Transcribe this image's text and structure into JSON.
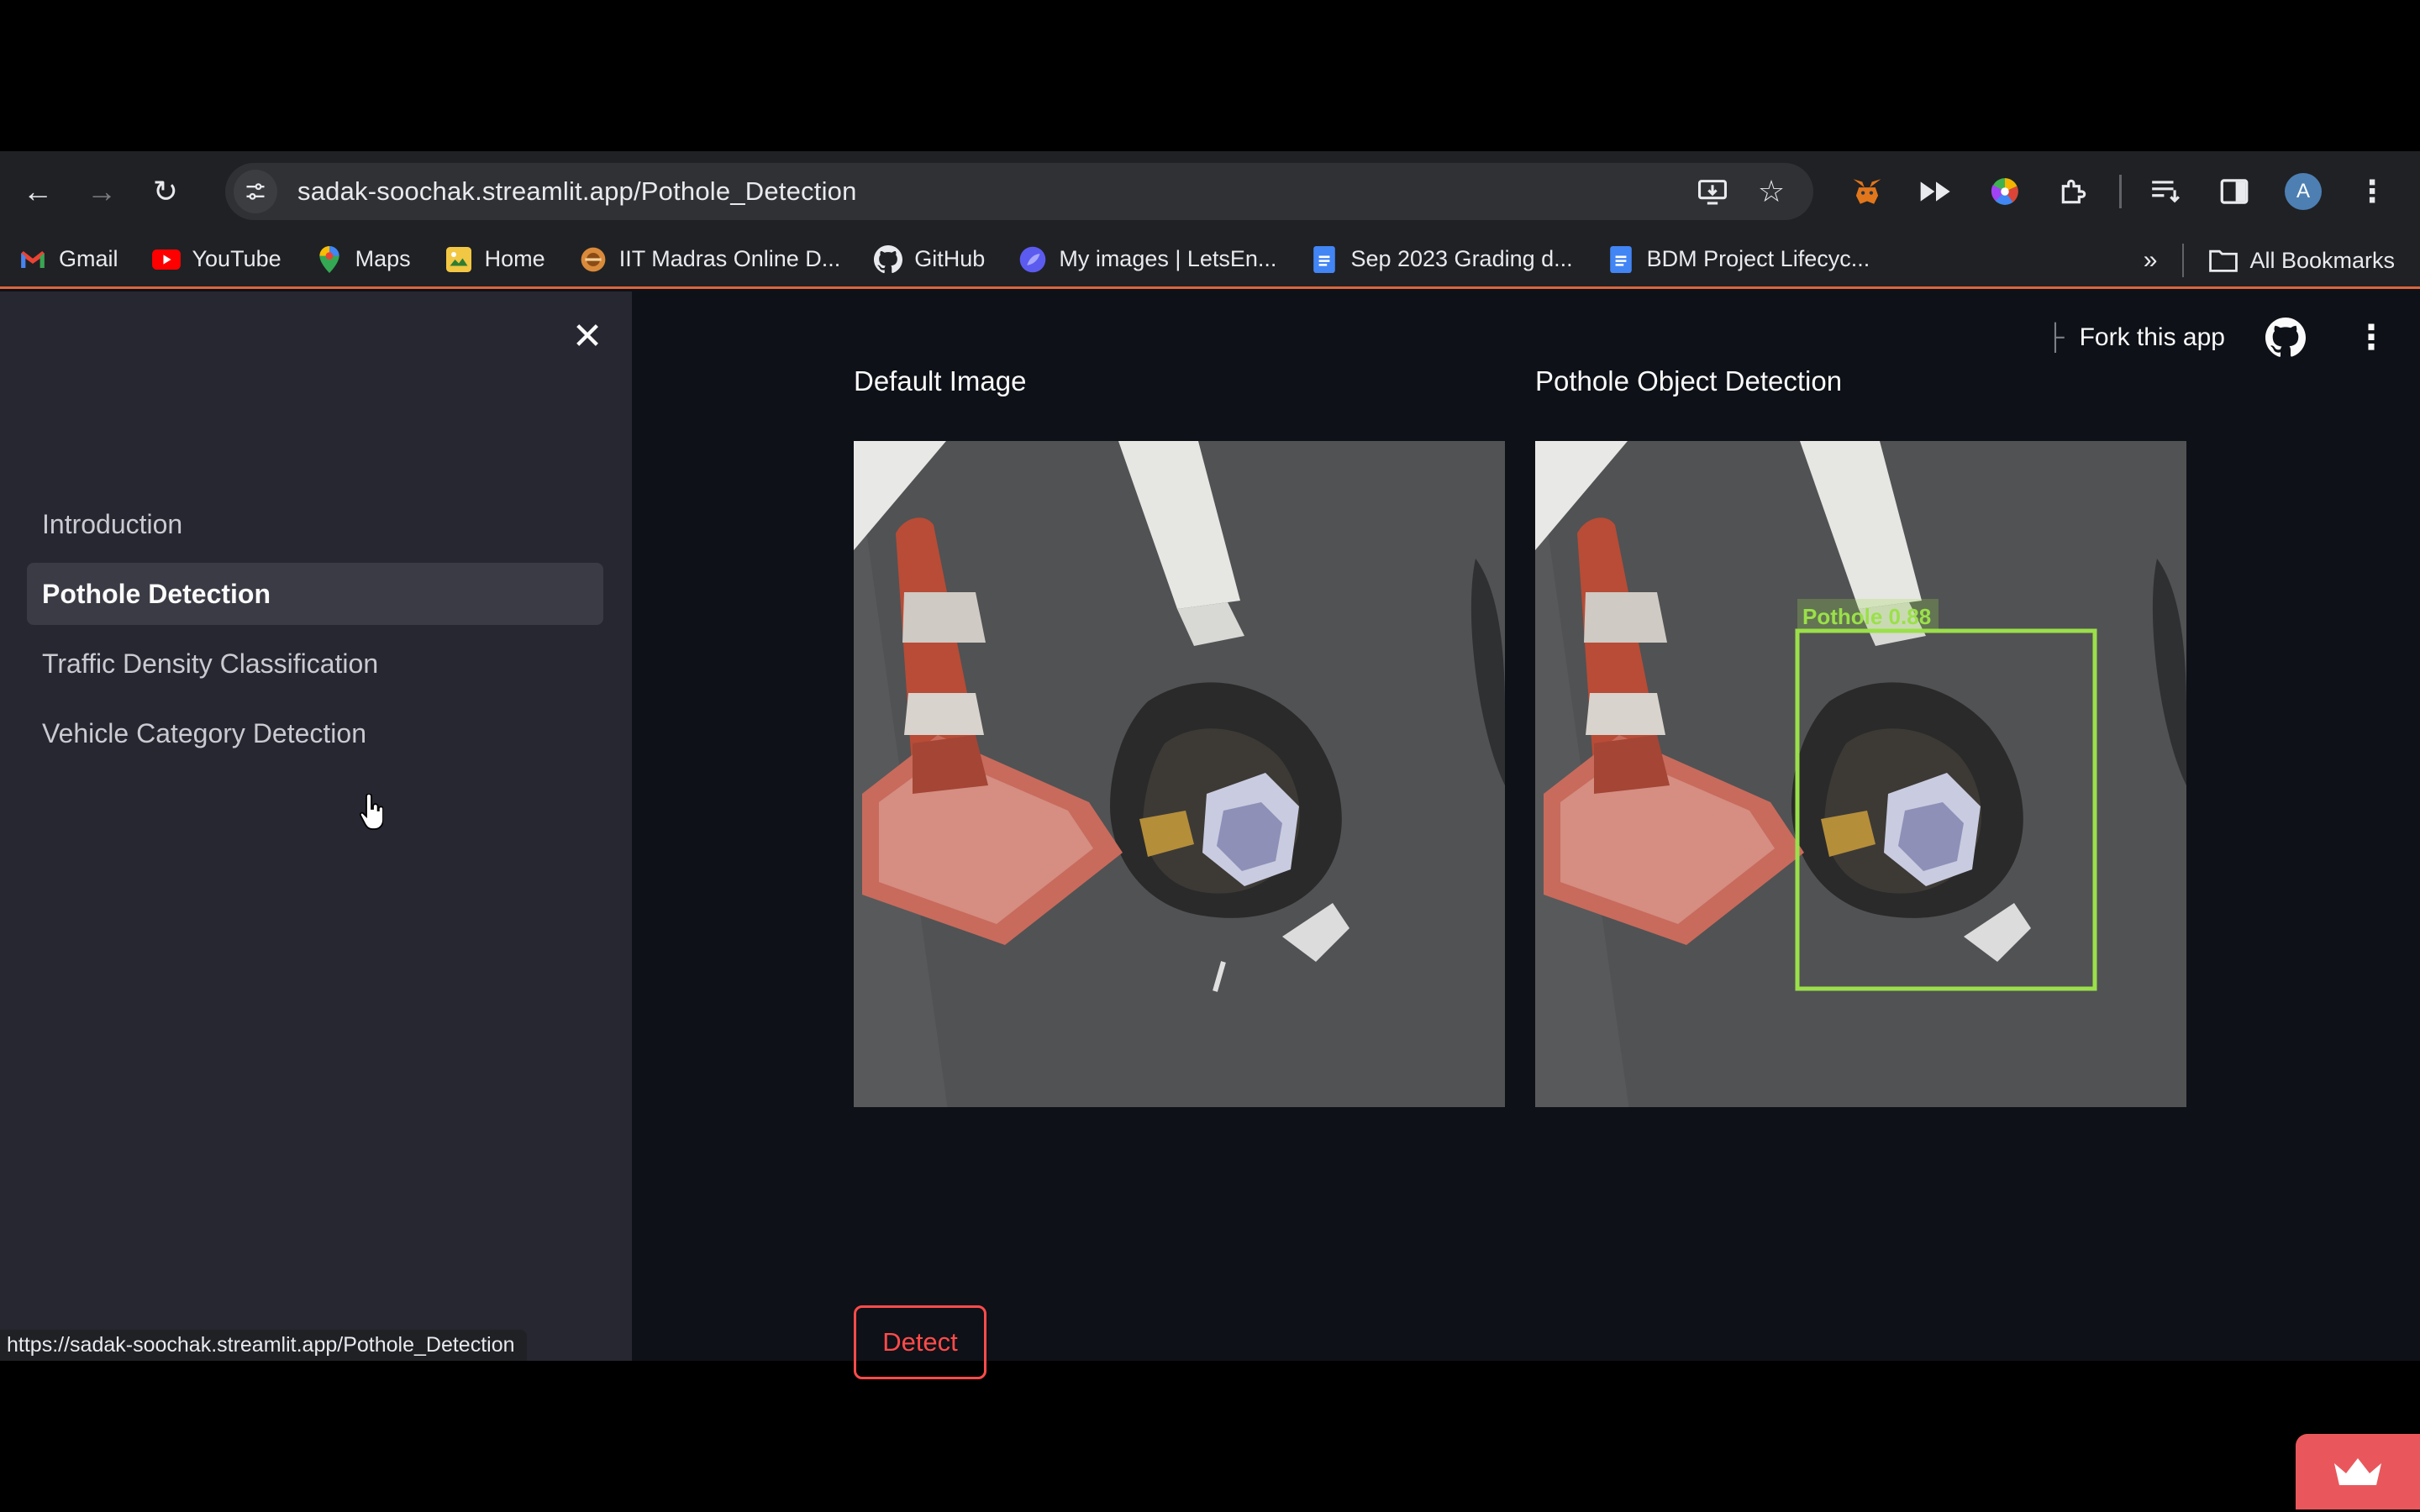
{
  "browser": {
    "url": "sadak-soochak.streamlit.app/Pothole_Detection",
    "avatar_letter": "A",
    "bookmarks": [
      {
        "label": "Gmail"
      },
      {
        "label": "YouTube"
      },
      {
        "label": "Maps"
      },
      {
        "label": "Home"
      },
      {
        "label": "IIT Madras Online D..."
      },
      {
        "label": "GitHub"
      },
      {
        "label": "My images | LetsEn..."
      },
      {
        "label": "Sep 2023 Grading d..."
      },
      {
        "label": "BDM Project Lifecyc..."
      }
    ],
    "all_bookmarks": "All Bookmarks",
    "status_url": "https://sadak-soochak.streamlit.app/Pothole_Detection"
  },
  "sidebar": {
    "items": [
      {
        "label": "Introduction"
      },
      {
        "label": "Pothole Detection"
      },
      {
        "label": "Traffic Density Classification"
      },
      {
        "label": "Vehicle Category Detection"
      }
    ]
  },
  "header": {
    "fork_label": "Fork this app"
  },
  "main": {
    "left_title": "Default Image",
    "right_title": "Pothole Object Detection",
    "detection_label": "Pothole 0.88",
    "detect_button": "Detect"
  },
  "colors": {
    "accent": "#ff4b4b",
    "detection_box": "#9be04a",
    "sidebar_bg": "#262730",
    "app_bg": "#0e1117"
  }
}
